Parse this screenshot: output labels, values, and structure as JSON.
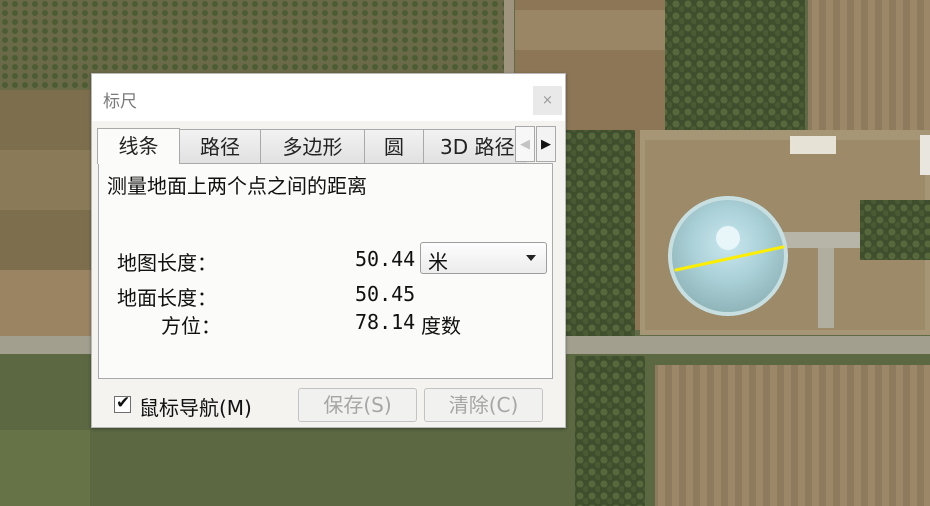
{
  "dialog": {
    "title": "标尺",
    "close_glyph": "×",
    "tabs": [
      {
        "label": "线条"
      },
      {
        "label": "路径"
      },
      {
        "label": "多边形"
      },
      {
        "label": "圆"
      },
      {
        "label": "3D 路径"
      }
    ],
    "tab_scroll_left_glyph": "◀",
    "tab_scroll_right_glyph": "▶",
    "description": "测量地面上两个点之间的距离",
    "map_length": {
      "label": "地图长度：",
      "value": "50.44"
    },
    "unit_select": {
      "selected": "米"
    },
    "ground_length": {
      "label": "地面长度：",
      "value": "50.45"
    },
    "heading": {
      "label": "方位：",
      "value": "78.14",
      "unit": "度数"
    },
    "mouse_nav": {
      "label": "鼠标导航(M)",
      "checked": true,
      "check_glyph": "✔"
    },
    "save_button": "保存(S)",
    "clear_button": "清除(C)"
  },
  "measure_line_color": "#ffee00"
}
